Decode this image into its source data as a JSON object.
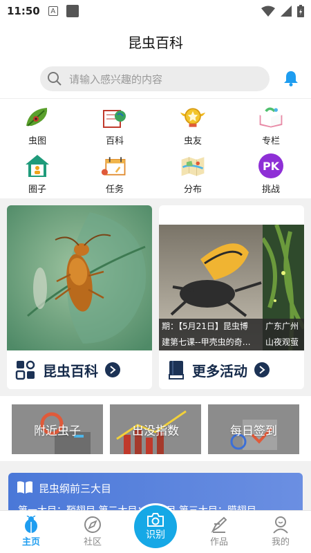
{
  "status_bar": {
    "time": "11:50",
    "a_icon_text": "A"
  },
  "header": {
    "title": "昆虫百科"
  },
  "search": {
    "placeholder": "请输入感兴趣的内容"
  },
  "categories": [
    {
      "label": "虫图",
      "icon": "leaf-bug-icon"
    },
    {
      "label": "百科",
      "icon": "book-globe-icon"
    },
    {
      "label": "虫友",
      "icon": "gold-medal-icon"
    },
    {
      "label": "专栏",
      "icon": "open-book-icon"
    },
    {
      "label": "圈子",
      "icon": "home-person-icon"
    },
    {
      "label": "任务",
      "icon": "calendar-icon"
    },
    {
      "label": "分布",
      "icon": "map-icon"
    },
    {
      "label": "挑战",
      "icon": "pk-icon",
      "icon_text": "PK"
    }
  ],
  "cards": {
    "encyclopedia": {
      "label": "昆虫百科"
    },
    "activities": {
      "label": "更多活动",
      "slides": [
        {
          "caption_line1": "期：【5月21日】昆虫博",
          "caption_line2": "建第七课--甲壳虫的奇…"
        },
        {
          "caption_line1": "广东广州",
          "caption_line2": "山夜观萤"
        }
      ]
    }
  },
  "quick_actions": [
    {
      "label": "附近虫子"
    },
    {
      "label": "出没指数"
    },
    {
      "label": "每日签到"
    }
  ],
  "banner": {
    "title": "昆虫纲前三大目",
    "line": "第一大目：鞘翅目 第二大目：鳞翅目 第三大目：膜翅目"
  },
  "tabs": [
    {
      "label": "主页",
      "active": true
    },
    {
      "label": "社区",
      "active": false
    },
    {
      "label": "识别",
      "active": false
    },
    {
      "label": "作品",
      "active": false
    },
    {
      "label": "我的",
      "active": false
    }
  ],
  "colors": {
    "accent": "#1e9df0",
    "navy": "#152a4a",
    "banner": "#4a78d8"
  }
}
